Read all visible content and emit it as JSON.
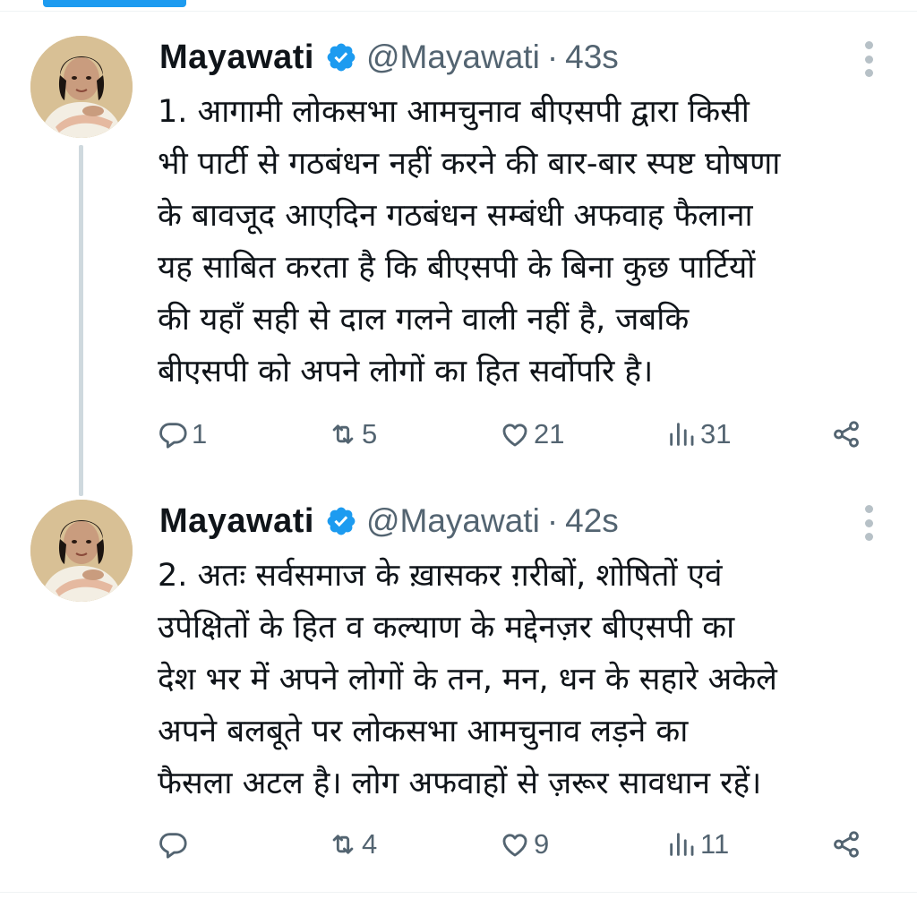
{
  "colors": {
    "accent": "#1d9bf0",
    "text": "#0f1419",
    "muted": "#536471",
    "divider": "#eff3f4"
  },
  "tweets": [
    {
      "display_name": "Mayawati",
      "handle": "@Mayawati",
      "separator": "·",
      "time": "43s",
      "text": "1. आगामी लोकसभा आमचुनाव बीएसपी द्वारा किसी\nभी पार्टी से गठबंधन नहीं करने की बार-बार स्पष्ट घोषणा\nके बावजूद आएदिन गठबंधन सम्बंधी अफवाह फैलाना\nयह साबित करता है कि बीएसपी के बिना कुछ पार्टियों\nकी यहाँ सही से दाल गलने वाली नहीं है, जबकि\nबीएसपी को अपने लोगों का हित सर्वोपरि है।",
      "replies": "1",
      "retweets": "5",
      "likes": "21",
      "views": "31",
      "icons": {
        "reply": "reply-icon",
        "retweet": "retweet-icon",
        "like": "heart-icon",
        "views": "views-icon",
        "share": "share-icon",
        "more": "more-vertical-icon",
        "verified": "verified-badge-icon"
      }
    },
    {
      "display_name": "Mayawati",
      "handle": "@Mayawati",
      "separator": "·",
      "time": "42s",
      "text": "2. अतः सर्वसमाज के ख़ासकर ग़रीबों, शोषितों एवं\nउपेक्षितों के हित व कल्याण के मद्देनज़र बीएसपी का\nदेश भर में अपने लोगों के तन, मन, धन के सहारे अकेले\nअपने बलबूते पर लोकसभा आमचुनाव लड़ने का\nफैसला अटल है। लोग अफवाहों से ज़रूर सावधान रहें।",
      "replies": "",
      "retweets": "4",
      "likes": "9",
      "views": "11",
      "icons": {
        "reply": "reply-icon",
        "retweet": "retweet-icon",
        "like": "heart-icon",
        "views": "views-icon",
        "share": "share-icon",
        "more": "more-vertical-icon",
        "verified": "verified-badge-icon"
      }
    }
  ]
}
